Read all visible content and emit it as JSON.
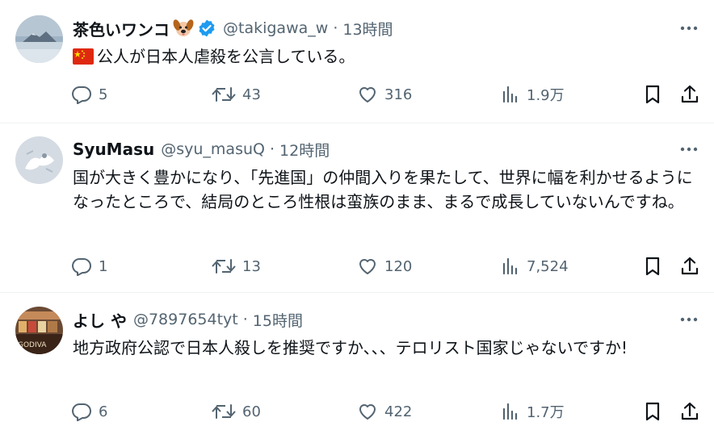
{
  "tweets": [
    {
      "name": "茶色いワンコ",
      "handle": "@takigawa_w",
      "sep": "·",
      "time": "13時間",
      "text": "公人が日本人虐殺を公言している。",
      "replies": "5",
      "retweets": "43",
      "likes": "316",
      "views": "1.9万"
    },
    {
      "name": "SyuMasu",
      "handle": "@syu_masuQ",
      "sep": "·",
      "time": "12時間",
      "text": "国が大きく豊かになり、「先進国」の仲間入りを果たして、世界に幅を利かせるようになったところで、結局のところ性根は蛮族のまま、まるで成長していないんですね。",
      "replies": "1",
      "retweets": "13",
      "likes": "120",
      "views": "7,524"
    },
    {
      "name": "よし や",
      "handle": "@7897654tyt",
      "sep": "·",
      "time": "15時間",
      "text": "地方政府公認で日本人殺しを推奨ですか、、、テロリスト国家じゃないですか!",
      "replies": "6",
      "retweets": "60",
      "likes": "422",
      "views": "1.7万"
    }
  ],
  "avatar3_logo": "GODIVA",
  "colors": {
    "text": "#0f1419",
    "muted": "#536471",
    "verified": "#1d9bf0",
    "divider": "#eff3f4"
  }
}
